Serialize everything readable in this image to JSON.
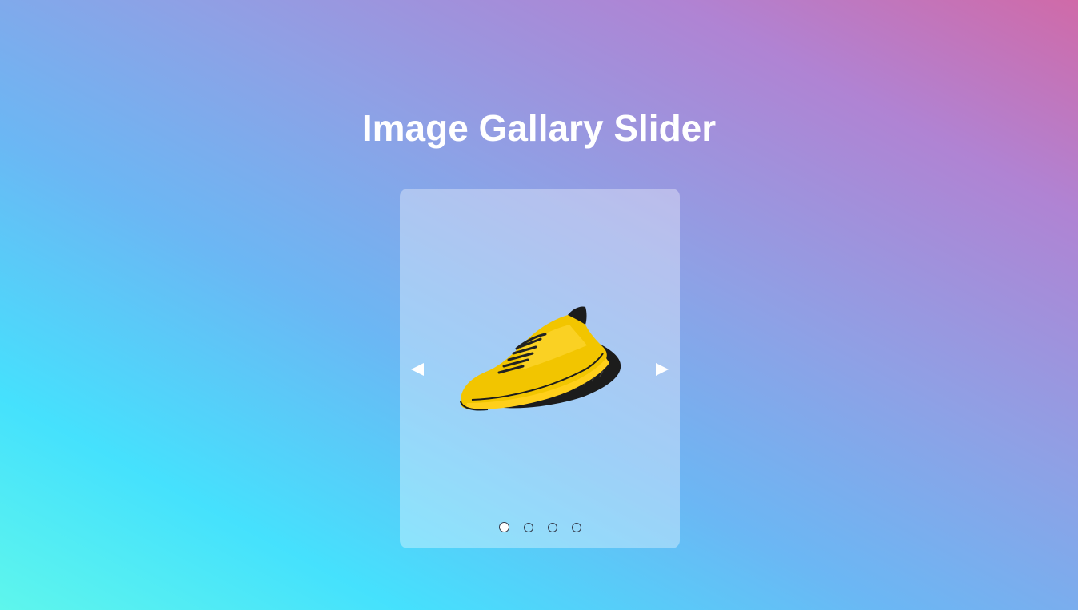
{
  "page": {
    "title": "Image Gallary Slider"
  },
  "slider": {
    "slide_count": 4,
    "active_index": 0,
    "current_slide": {
      "image": "yellow-running-shoe"
    },
    "prev_icon": "triangle-left-icon",
    "next_icon": "triangle-right-icon"
  },
  "colors": {
    "title": "#ffffff",
    "arrow": "#ffffff",
    "dot_border": "#333a4a",
    "dot_active": "#ffffff",
    "shoe_primary": "#f2c500",
    "shoe_sole": "#1c1c1c"
  }
}
